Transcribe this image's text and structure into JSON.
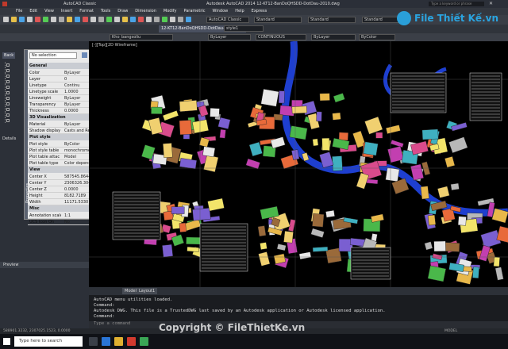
{
  "window": {
    "title": "Autodesk AutoCAD 2014   12-KT12-BanDoQHSDD-DotDau-2010.dwg",
    "workspace": "AutoCAD Classic",
    "search_placeholder": "Type a keyword or phrase"
  },
  "menubar": [
    "File",
    "Edit",
    "View",
    "Insert",
    "Format",
    "Tools",
    "Draw",
    "Dimension",
    "Modify",
    "Parametric",
    "Window",
    "Help",
    "Express"
  ],
  "toolbar": {
    "workspace_combo": "AutoCAD Classic",
    "file_tab": "12-KT12-BanDoQHSDD-DotDau-2010*",
    "layer_combo": "Kho_bangsoliu",
    "color_combo": "ByLayer",
    "linetype_combo": "CONTINUOUS",
    "lineweight_combo": "ByLayer",
    "plotstyle_combo": "ByColor",
    "textstyle_combo": "Standard",
    "dimstyle_combo": "Standard",
    "tablestyle_combo": "Standard",
    "mleader_combo": "style1"
  },
  "leftpanel": {
    "tab_back": "Back",
    "section_details": "Details",
    "section_preview": "Preview"
  },
  "properties": {
    "selection": "No selection",
    "side_label": "Properties",
    "sections": {
      "general": "General",
      "visualizations": "3D Visualization",
      "plot": "Plot style",
      "view": "View",
      "misc": "Misc"
    },
    "general": [
      {
        "key": "Color",
        "value": "ByLayer"
      },
      {
        "key": "Layer",
        "value": "0"
      },
      {
        "key": "Linetype",
        "value": "Continu"
      },
      {
        "key": "Linetype scale",
        "value": "1.0000"
      },
      {
        "key": "Lineweight",
        "value": "ByLayer"
      },
      {
        "key": "Transparency",
        "value": "ByLayer"
      },
      {
        "key": "Thickness",
        "value": "0.0000"
      }
    ],
    "visualization": [
      {
        "key": "Material",
        "value": "ByLayer"
      },
      {
        "key": "Shadow display",
        "value": "Casts and Receives"
      }
    ],
    "plot": [
      {
        "key": "Plot style",
        "value": "ByColor"
      },
      {
        "key": "Plot style table",
        "value": "monochrome.ctb"
      },
      {
        "key": "Plot table attac",
        "value": "Model"
      },
      {
        "key": "Plot table type",
        "value": "Color dependent"
      }
    ],
    "view": [
      {
        "key": "Center X",
        "value": "587545.8644"
      },
      {
        "key": "Center Y",
        "value": "2306326.3048"
      },
      {
        "key": "Center Z",
        "value": "0.0000"
      },
      {
        "key": "Height",
        "value": "8182.7189"
      },
      {
        "key": "Width",
        "value": "11171.5330"
      }
    ],
    "misc": [
      {
        "key": "Annotation scale",
        "value": "1:1"
      },
      {
        "key": "UCS Icon On",
        "value": "No"
      }
    ]
  },
  "drawing": {
    "viewport_label": "[-][Top][2D Wireframe]"
  },
  "layout_tabs": [
    "Model",
    "Layout1"
  ],
  "command": {
    "lines": [
      "AutoCAD menu utilities loaded.",
      "Command:",
      "Autodesk DWG.  This file is a TrustedDWG last saved by an Autodesk application or Autodesk licensed application.",
      "Command:"
    ],
    "prompt": "Type a command"
  },
  "statusbar": {
    "coords": "588901.3232, 2307025.1523, 0.0000",
    "mode": "MODEL"
  },
  "taskbar": {
    "search": "Type here to search"
  },
  "watermark": "Copyright © FileThietKe.vn",
  "logo_text": "File Thiết Kế.vn",
  "colors": {
    "panel_bg": "#2c3038",
    "accent_blue": "#3a7bd5",
    "drawing_bg": "#000000"
  }
}
